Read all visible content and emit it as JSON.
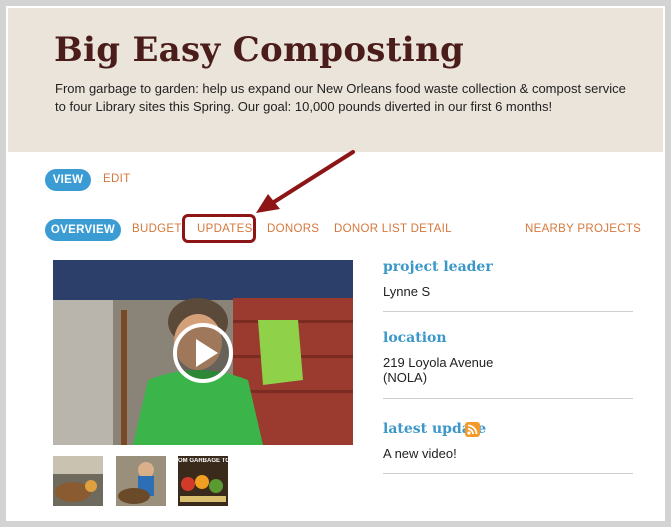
{
  "header": {
    "title": "Big Easy Composting",
    "tagline": "From garbage to garden: help us expand our New Orleans food waste collection & compost service to four Library sites this Spring. Our goal: 10,000 pounds diverted in our first 6 months!"
  },
  "mode_tabs": {
    "view": "VIEW",
    "edit": "EDIT"
  },
  "project_tabs": {
    "overview": "OVERVIEW",
    "budget": "BUDGET",
    "updates": "UPDATES",
    "donors": "DONORS",
    "donor_list_detail": "DONOR LIST DETAIL",
    "nearby_projects": "NEARBY PROJECTS"
  },
  "sidebar": {
    "project_leader": {
      "heading": "project leader",
      "value": "Lynne S"
    },
    "location": {
      "heading": "location",
      "line1": "219 Loyola Avenue",
      "line2": "(NOLA)"
    },
    "latest_update": {
      "heading": "latest update",
      "value": "A new video!",
      "icon": "rss-icon"
    }
  },
  "media": {
    "video_icon": "play-icon",
    "thumb3_text": "OM GARBAGE TO GARD"
  },
  "colors": {
    "accent_blue": "#3b9cd4",
    "link_orange": "#d5783c",
    "title_brown": "#4a1d1a",
    "header_bg": "#ebe4da",
    "annotation_red": "#8e1516"
  }
}
